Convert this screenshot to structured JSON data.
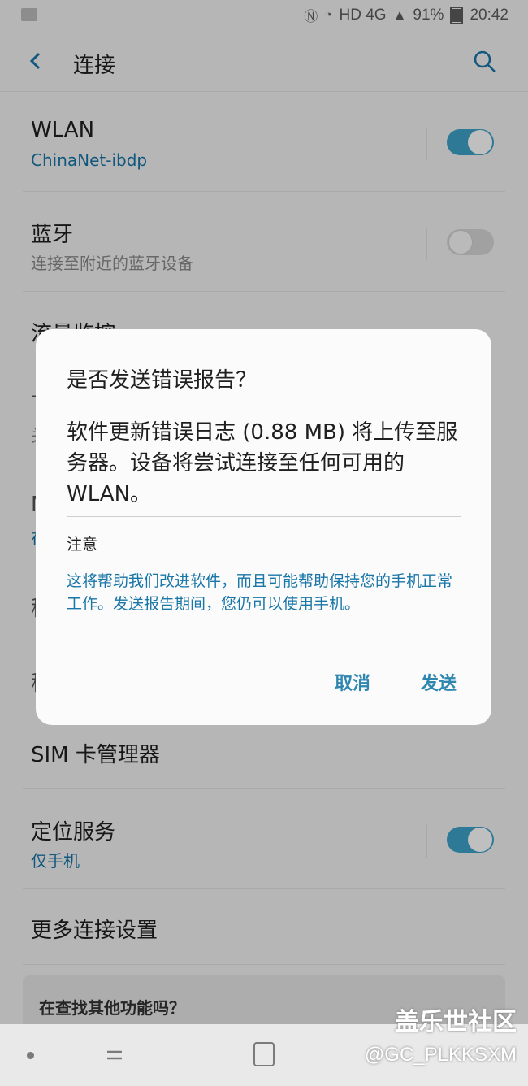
{
  "status_bar": {
    "network_label": "HD 4G",
    "battery_percent": "91%",
    "time": "20:42"
  },
  "app_bar": {
    "title": "连接"
  },
  "settings": {
    "wlan": {
      "title": "WLAN",
      "subtitle": "ChinaNet-ibdp",
      "enabled": true
    },
    "bluetooth": {
      "title": "蓝牙",
      "subtitle": "连接至附近的蓝牙设备",
      "enabled": false
    },
    "data_usage": {
      "title": "流量监控"
    },
    "sim_manager": {
      "title": "SIM 卡管理器"
    },
    "location": {
      "title": "定位服务",
      "subtitle": "仅手机",
      "enabled": true
    },
    "more": {
      "title": "更多连接设置"
    }
  },
  "obscured_rows": {
    "row1_letter": "飞",
    "row1_sub_letter": "关",
    "row2_letter": "N",
    "row2_sub_letter": "在",
    "row3_letter": "移",
    "row4_letter": "移"
  },
  "help_card": {
    "title": "在查找其他功能吗？"
  },
  "dialog": {
    "title": "是否发送错误报告？",
    "message": "软件更新错误日志 (0.88 MB) 将上传至服务器。设备将尝试连接至任何可用的 WLAN。",
    "note_title": "注意",
    "note_body": "这将帮助我们改进软件，而且可能帮助保持您的手机正常工作。发送报告期间，您仍可以使用手机。",
    "cancel_label": "取消",
    "send_label": "发送"
  },
  "watermark": {
    "line1": "盖乐世社区",
    "line2": "@GC_PLKKSXM"
  },
  "colors": {
    "accent": "#3ea3c8",
    "link": "#1976a8",
    "button": "#2f87b0"
  }
}
